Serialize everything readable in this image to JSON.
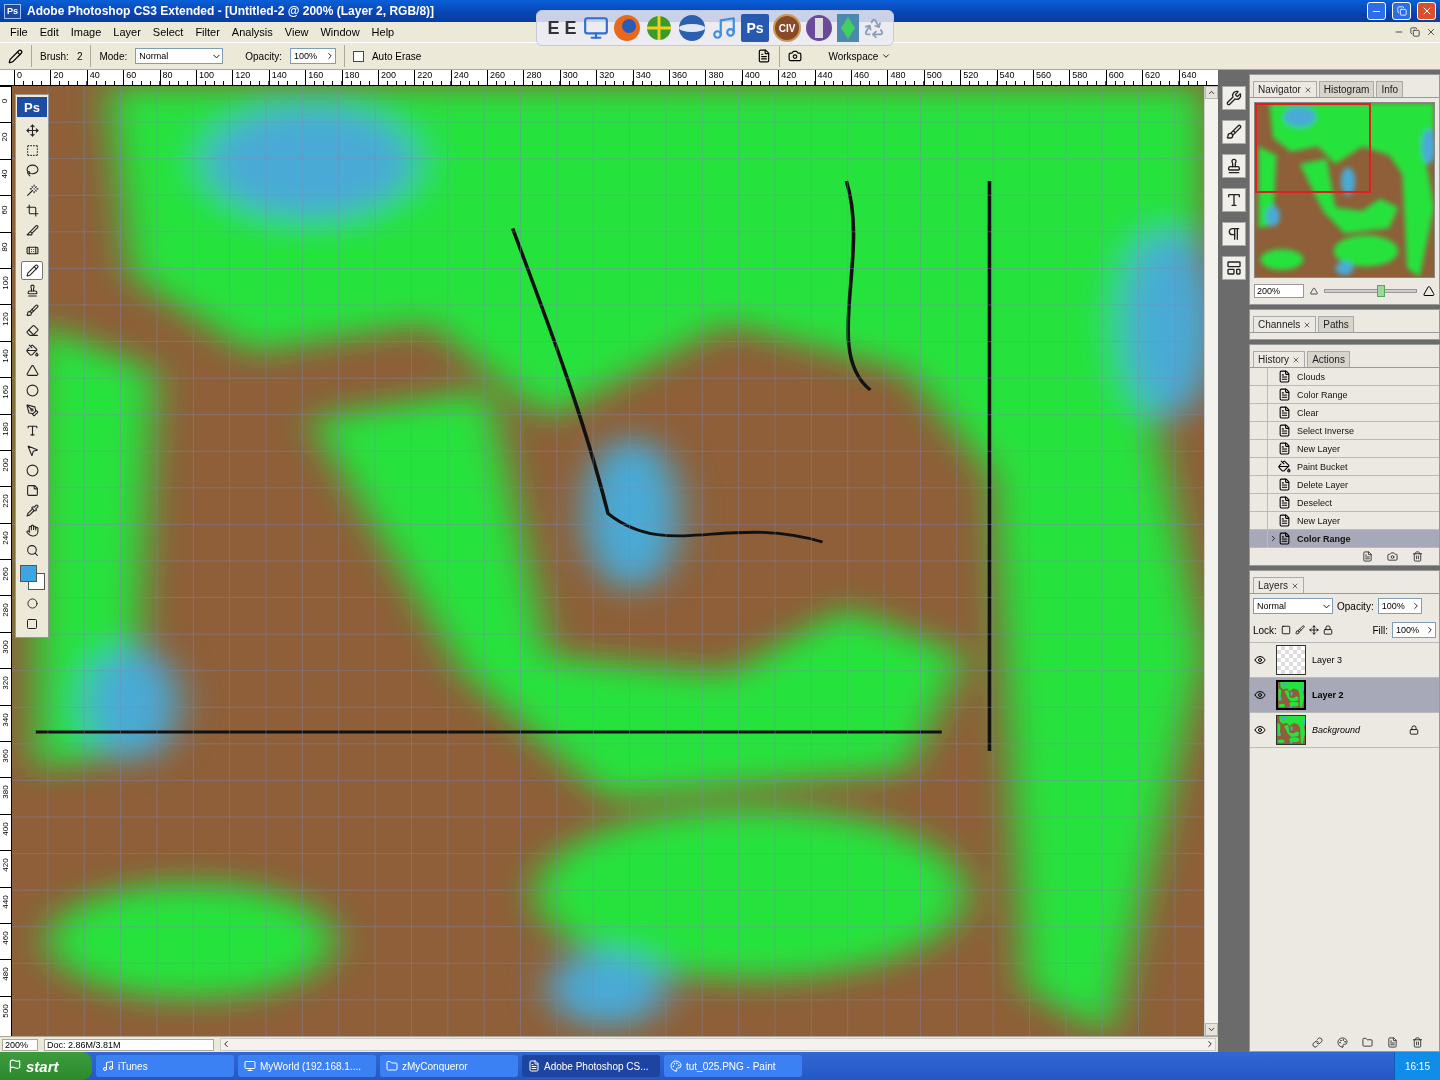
{
  "window": {
    "title": "Adobe Photoshop CS3 Extended - [Untitled-2 @ 200% (Layer 2, RGB/8)]",
    "app_icon": "Ps"
  },
  "menu": [
    "File",
    "Edit",
    "Image",
    "Layer",
    "Select",
    "Filter",
    "Analysis",
    "View",
    "Window",
    "Help"
  ],
  "dock": [
    {
      "kind": "letters",
      "label": "E E"
    },
    {
      "kind": "network"
    },
    {
      "kind": "firefox"
    },
    {
      "kind": "globe"
    },
    {
      "kind": "sphere"
    },
    {
      "kind": "music"
    },
    {
      "kind": "app",
      "label": "Ps"
    },
    {
      "kind": "badge",
      "label": "CIV"
    },
    {
      "kind": "disc"
    },
    {
      "kind": "gem"
    },
    {
      "kind": "recycle"
    }
  ],
  "options": {
    "brush_label": "Brush:",
    "brush_size": "2",
    "mode_label": "Mode:",
    "mode": "Normal",
    "opacity_label": "Opacity:",
    "opacity": "100%",
    "auto_erase": {
      "label": "Auto Erase",
      "checked": false
    },
    "workspace": "Workspace"
  },
  "ruler": {
    "h_ticks": [
      "0",
      "20",
      "40",
      "60",
      "80",
      "100",
      "120",
      "140",
      "160",
      "180",
      "200",
      "220",
      "240",
      "260",
      "280",
      "300",
      "320",
      "340",
      "360",
      "380",
      "400",
      "420",
      "440",
      "460",
      "480",
      "500",
      "520",
      "540",
      "560",
      "580",
      "600",
      "620",
      "640"
    ],
    "v_ticks": [
      "0",
      "20",
      "40",
      "60",
      "80",
      "100",
      "120",
      "140",
      "160",
      "180",
      "200",
      "220",
      "240",
      "260",
      "280",
      "300",
      "320",
      "340",
      "360",
      "380",
      "400",
      "420",
      "440",
      "460",
      "480",
      "500"
    ]
  },
  "toolbox_logo": "Ps",
  "tools": [
    {
      "kind": "move",
      "selected": false
    },
    {
      "kind": "marquee",
      "selected": false
    },
    {
      "kind": "lasso",
      "selected": false
    },
    {
      "kind": "wand",
      "selected": false
    },
    {
      "kind": "crop",
      "selected": false
    },
    {
      "kind": "slice",
      "selected": false
    },
    {
      "kind": "heal",
      "selected": false
    },
    {
      "kind": "pencil",
      "selected": true
    },
    {
      "kind": "stamp",
      "selected": false
    },
    {
      "kind": "history",
      "selected": false
    },
    {
      "kind": "eraser",
      "selected": false
    },
    {
      "kind": "bucket",
      "selected": false
    },
    {
      "kind": "blur",
      "selected": false
    },
    {
      "kind": "dodge",
      "selected": false
    },
    {
      "kind": "pen",
      "selected": false
    },
    {
      "kind": "type",
      "selected": false
    },
    {
      "kind": "select",
      "selected": false
    },
    {
      "kind": "ellipse",
      "selected": false
    },
    {
      "kind": "notes",
      "selected": false
    },
    {
      "kind": "eyedropper",
      "selected": false
    },
    {
      "kind": "hand",
      "selected": false
    },
    {
      "kind": "zoom",
      "selected": false
    }
  ],
  "navigator": {
    "tabs": [
      {
        "label": "Navigator",
        "selected": true
      },
      {
        "label": "Histogram",
        "selected": false
      },
      {
        "label": "Info",
        "selected": false
      }
    ],
    "zoom": "200%",
    "level": 0.62
  },
  "channels": {
    "tabs": [
      {
        "label": "Channels",
        "selected": true
      },
      {
        "label": "Paths",
        "selected": false
      }
    ]
  },
  "history": {
    "tabs": [
      {
        "label": "History",
        "selected": true
      },
      {
        "label": "Actions",
        "selected": false
      }
    ],
    "items": [
      {
        "label": "Clouds",
        "kind": "step",
        "selected": false
      },
      {
        "label": "Color Range",
        "kind": "step",
        "selected": false
      },
      {
        "label": "Clear",
        "kind": "step",
        "selected": false
      },
      {
        "label": "Select Inverse",
        "kind": "step",
        "selected": false
      },
      {
        "label": "New Layer",
        "kind": "step",
        "selected": false
      },
      {
        "label": "Paint Bucket",
        "kind": "bucket",
        "selected": false
      },
      {
        "label": "Delete Layer",
        "kind": "step",
        "selected": false
      },
      {
        "label": "Deselect",
        "kind": "step",
        "selected": false
      },
      {
        "label": "New Layer",
        "kind": "step",
        "selected": false
      },
      {
        "label": "Color Range",
        "kind": "step",
        "selected": true
      }
    ]
  },
  "layers": {
    "tabs": [
      {
        "label": "Layers",
        "selected": true
      }
    ],
    "blend": "Normal",
    "opacity_label": "Opacity:",
    "opacity": "100%",
    "lock_label": "Lock:",
    "fill_label": "Fill:",
    "fill": "100%",
    "items": [
      {
        "name": "Layer 3",
        "kind": "transparent",
        "visible": true,
        "selected": false,
        "locked": false
      },
      {
        "name": "Layer 2",
        "kind": "painted",
        "visible": true,
        "selected": true,
        "locked": false
      },
      {
        "name": "Background",
        "kind": "background",
        "visible": true,
        "selected": false,
        "locked": true
      }
    ]
  },
  "status": {
    "zoom": "200%",
    "doc": "Doc: 2.86M/3.81M"
  },
  "taskbar": {
    "start": "start",
    "items": [
      {
        "label": "iTunes",
        "kind": "music",
        "selected": false
      },
      {
        "label": "MyWorld (192.168.1....",
        "kind": "computer",
        "selected": false
      },
      {
        "label": "zMyConqueror",
        "kind": "folder",
        "selected": false
      },
      {
        "label": "Adobe Photoshop CS...",
        "kind": "ps",
        "selected": true
      },
      {
        "label": "tut_025.PNG - Paint",
        "kind": "paint",
        "selected": false
      }
    ],
    "clock": "16:15"
  }
}
